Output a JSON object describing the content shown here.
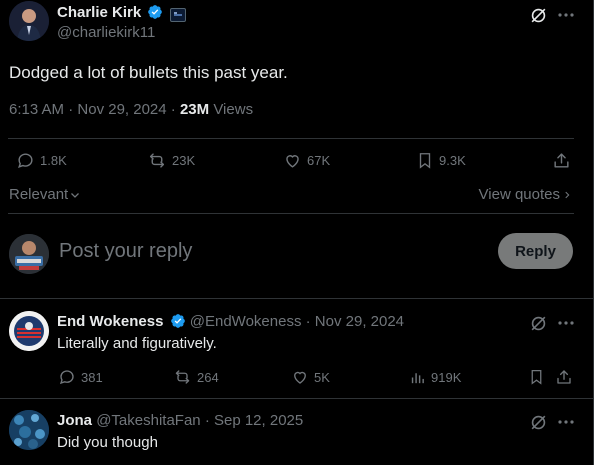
{
  "main_tweet": {
    "author_name": "Charlie Kirk",
    "author_handle": "@charliekirk11",
    "text": "Dodged a lot of bullets this past year.",
    "time": "6:13 AM",
    "sep": "·",
    "date": "Nov 29, 2024",
    "views_count": "23M",
    "views_label": "Views",
    "stats": {
      "replies": "1.8K",
      "reposts": "23K",
      "likes": "67K",
      "bookmarks": "9.3K"
    }
  },
  "filters": {
    "sort": "Relevant",
    "view_quotes": "View quotes"
  },
  "compose": {
    "placeholder": "Post your reply",
    "reply_button": "Reply"
  },
  "replies": [
    {
      "author_name": "End Wokeness",
      "author_handle": "@EndWokeness",
      "sep": "·",
      "date": "Nov 29, 2024",
      "text": "Literally and figuratively.",
      "stats": {
        "replies": "381",
        "reposts": "264",
        "likes": "5K",
        "views": "919K"
      }
    },
    {
      "author_name": "Jona",
      "author_handle": "@TakeshitaFan",
      "sep": "·",
      "date": "Sep 12, 2025",
      "text": "Did you though"
    }
  ],
  "colors": {
    "background": "#000000",
    "text": "#e7e9ea",
    "muted": "#71767b",
    "border": "#2f3336",
    "verified": "#1d9bf0",
    "reply_button": "#787a7a"
  },
  "icons": [
    "grok-icon",
    "more-icon",
    "reply-icon",
    "repost-icon",
    "like-icon",
    "bookmark-icon",
    "share-icon",
    "views-icon",
    "chevron-down-icon",
    "chevron-right-icon",
    "verified-icon"
  ]
}
